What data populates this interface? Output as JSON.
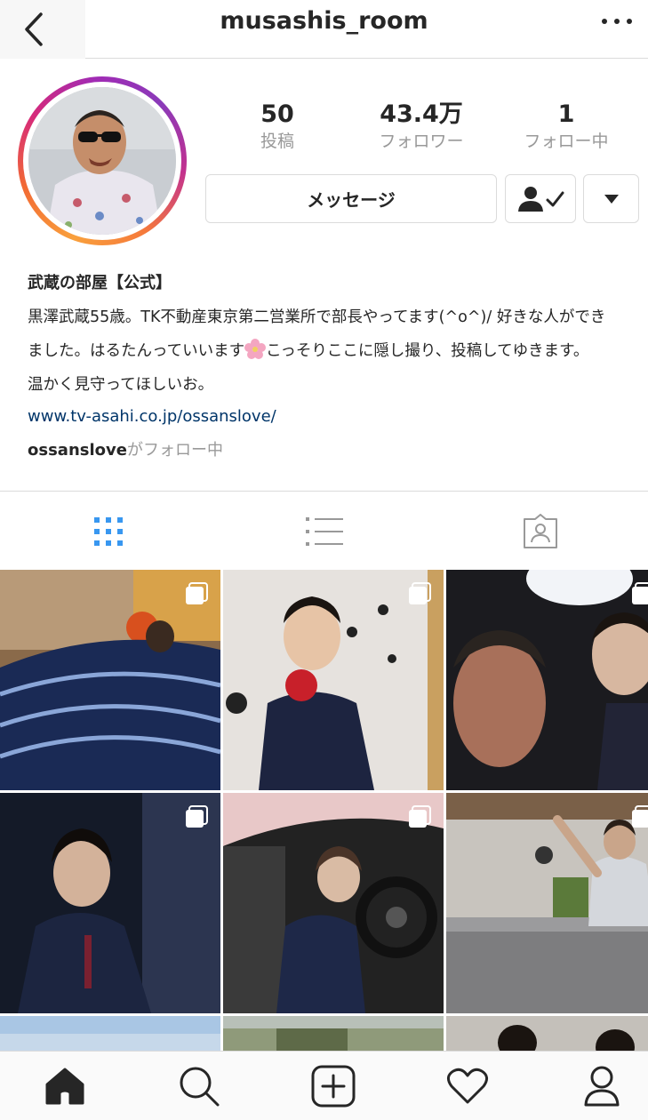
{
  "header": {
    "username": "musashis_room",
    "back": "back-icon",
    "more": "more-options-icon"
  },
  "profile": {
    "avatar": "profile-photo",
    "stats": [
      {
        "value": "50",
        "label": "投稿"
      },
      {
        "value": "43.4万",
        "label": "フォロワー"
      },
      {
        "value": "1",
        "label": "フォロー中"
      }
    ],
    "message_label": "メッセージ",
    "following_icon": "following-check-icon",
    "dropdown_icon": "chevron-down-icon"
  },
  "bio": {
    "name": "武蔵の部屋【公式】",
    "line1": "黒澤武蔵55歳。TK不動産東京第二営業所で部長やってます(^o^)/ 好きな人ができ",
    "line2a": "ました。はるたんっていいます",
    "line2b": "こっそりここに隠し撮り、投稿してゆきます。",
    "line3": "温かく見守ってほしいお。",
    "link": "www.tv-asahi.co.jp/ossanslove/",
    "followed_by_user": "ossanslove",
    "followed_by_text": "がフォロー中"
  },
  "tabs": [
    {
      "icon": "grid-view-icon",
      "active": true
    },
    {
      "icon": "list-view-icon",
      "active": false
    },
    {
      "icon": "tagged-photos-icon",
      "active": false
    }
  ],
  "bottom_nav": [
    {
      "icon": "home-icon"
    },
    {
      "icon": "search-icon"
    },
    {
      "icon": "new-post-icon"
    },
    {
      "icon": "activity-heart-icon"
    },
    {
      "icon": "profile-icon"
    }
  ],
  "colors": {
    "accent_blue": "#3897f0",
    "link_blue": "#003569",
    "muted_text": "#999999",
    "border": "#dbdbdb"
  }
}
